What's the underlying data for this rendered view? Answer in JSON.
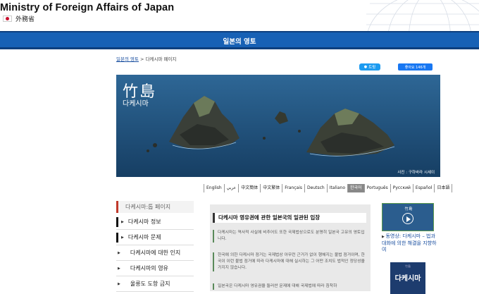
{
  "header": {
    "site_title": "Ministry of Foreign Affairs of Japan",
    "site_sub": "外務省"
  },
  "bar": {
    "title": "일본의 영토"
  },
  "breadcrumb": {
    "link": "일본의 영토",
    "separator": ">",
    "current": "다케시마 페이지"
  },
  "social": {
    "tweet": "트윗",
    "like": "좋아요 146개"
  },
  "hero": {
    "kanji": "竹島",
    "korean": "다케시마",
    "credit": "사진 : 구하바라 시세이"
  },
  "languages": [
    "English",
    "عربي",
    "中文簡体",
    "中文繁体",
    "Français",
    "Deutsch",
    "Italiano",
    "한국어",
    "Português",
    "Русский",
    "Español",
    "日本語"
  ],
  "active_language": "한국어",
  "sidenav": {
    "head": "다케시마:톱 페이지",
    "items": [
      {
        "label": "다케시마 정보",
        "type": "main"
      },
      {
        "label": "다케시마 문제",
        "type": "main"
      },
      {
        "label": "다케시마에 대한 인지",
        "type": "sub"
      },
      {
        "label": "다케시마의 영유",
        "type": "sub"
      },
      {
        "label": "울릉도 도항 금지",
        "type": "sub"
      }
    ]
  },
  "content": {
    "title": "다케시마 영유권에 관한 일본국의 일관된 입장",
    "paragraphs": [
      "다케시마는 역사적 사실에 비추어도 또한 국제법상으로도 분명히 일본국 고유의 영토입니다.",
      "한국에 의한 다케시마 점거는 국제법상 아무런 근거가 없이 행해지는 불법 점거이며, 한국이 이런 불법 점거에 따라 다케시마에 대해 실시하는 그 어떤 조치도 법적인 정당성을 가지지 않습니다.",
      "일본국은 다케시마 영유권을 둘러싼 문제에 대해 국제법에 따라 침착하"
    ]
  },
  "rightcol": {
    "video_title": "竹島",
    "video_link": "동영상: 다케시마 – 법과 대화에 의한 해결을 지향하여",
    "poster_sub": "竹島",
    "poster_title": "다케시마"
  },
  "colors": {
    "bar_blue": "#1761b5",
    "link_blue": "#1a4fa0",
    "accent_red": "#c0392b"
  }
}
